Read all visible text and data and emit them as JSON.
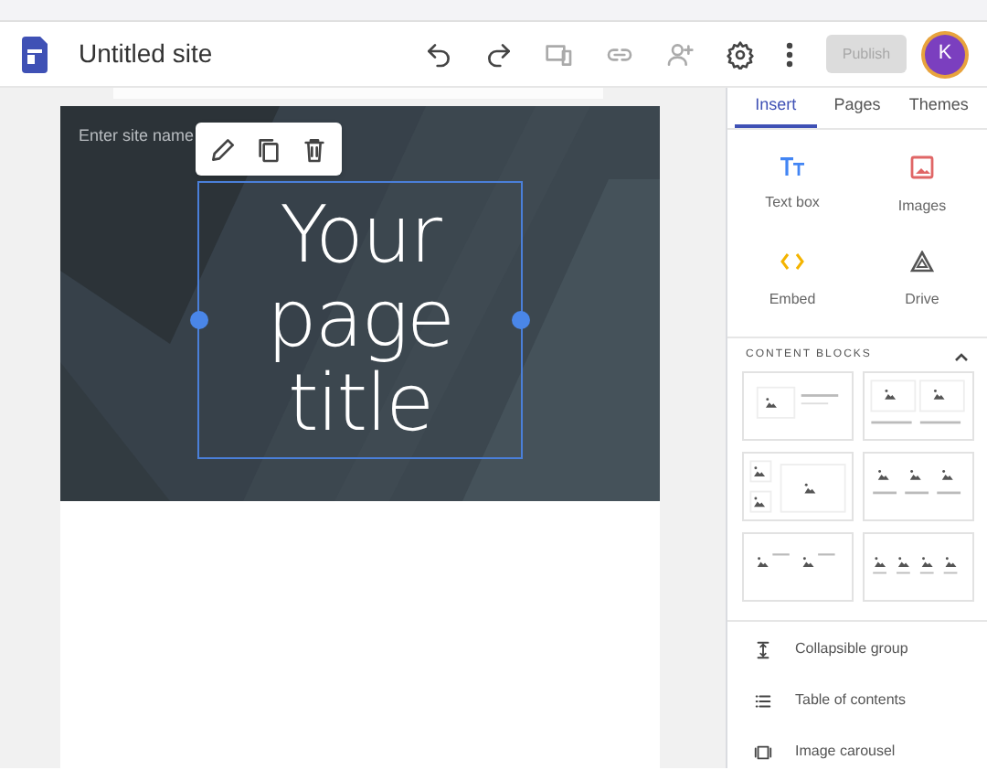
{
  "header": {
    "title": "Untitled site",
    "publish": {
      "label": "Publish",
      "disabled": true
    },
    "avatar": "K"
  },
  "canvas": {
    "site_name_placeholder": "Enter site name",
    "page_title": "Your page title",
    "title_selected": true
  },
  "sidebar": {
    "tabs": [
      {
        "label": "Insert",
        "selected": true
      },
      {
        "label": "Pages",
        "selected": false
      },
      {
        "label": "Themes",
        "selected": false
      }
    ],
    "insert_items": [
      {
        "kind": "textbox",
        "label": "Text box"
      },
      {
        "kind": "images",
        "label": "Images"
      },
      {
        "kind": "embed",
        "label": "Embed"
      },
      {
        "kind": "drive",
        "label": "Drive"
      }
    ],
    "content_blocks": {
      "title": "CONTENT BLOCKS",
      "expanded": true,
      "layouts": [
        {
          "kind": "image-text"
        },
        {
          "kind": "two-images"
        },
        {
          "kind": "image-grid"
        },
        {
          "kind": "three-images"
        },
        {
          "kind": "two-image-text"
        },
        {
          "kind": "four-images"
        }
      ]
    },
    "items": [
      {
        "kind": "collapsible",
        "label": "Collapsible group"
      },
      {
        "kind": "toc",
        "label": "Table of contents"
      },
      {
        "kind": "carousel",
        "label": "Image carousel"
      }
    ]
  }
}
